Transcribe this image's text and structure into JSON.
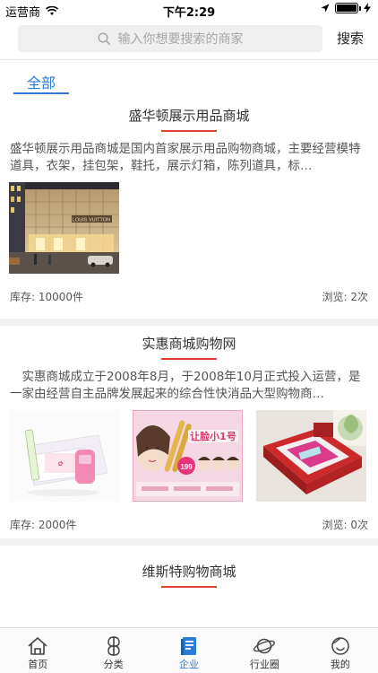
{
  "status_bar": {
    "carrier": "运营商",
    "time": "下午2:29"
  },
  "search": {
    "placeholder": "输入你想要搜索的商家",
    "button_label": "搜索"
  },
  "tabs": {
    "all_label": "全部"
  },
  "listings": [
    {
      "title": "盛华顿展示用品商城",
      "description": "盛华顿展示用品商城是国内首家展示用品购物商城，主要经营模特道具，衣架，挂包架，鞋托，展示灯箱，陈列道具，标…",
      "stock": "库存: 10000件",
      "views": "浏览: 2次",
      "images": [
        "storefront-photo"
      ],
      "storefront_sign_text": "LOUIS VUITTON"
    },
    {
      "title": "实惠商城购物网",
      "description": "　实惠商城成立于2008年8月，于2008年10月正式投入运营，是一家由经营自主品牌发展起来的综合性快消品大型购物商…",
      "stock": "库存: 2000件",
      "views": "浏览: 0次",
      "images": [
        "cosmetics-box-photo",
        "beauty-ad-photo",
        "gift-box-photo"
      ],
      "ad_banner_text": "让脸小1号",
      "ad_price_text": "199"
    },
    {
      "title": "维斯特购物商城"
    }
  ],
  "bottom_nav": [
    {
      "label": "首页",
      "icon": "home-icon"
    },
    {
      "label": "分类",
      "icon": "category-icon"
    },
    {
      "label": "企业",
      "icon": "enterprise-icon",
      "active": true
    },
    {
      "label": "行业圈",
      "icon": "planet-icon"
    },
    {
      "label": "我的",
      "icon": "profile-icon"
    }
  ],
  "colors": {
    "accent": "#2d7bd4",
    "title_underline": "#e23c2c",
    "search_bg": "#efefef"
  }
}
